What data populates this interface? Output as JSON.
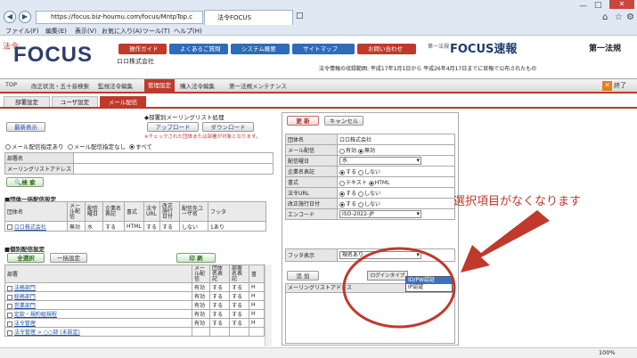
{
  "browser": {
    "url": "https://focus.biz-houmu.com/focus/MntpTop.c",
    "tab_title": "法令FOCUS",
    "menu": [
      "ファイル(F)",
      "編集(E)",
      "表示(V)",
      "お気に入り(A)",
      "ツール(T)",
      "ヘルプ(H)"
    ],
    "zoom": "100%"
  },
  "header": {
    "logo_small": "法令",
    "logo_main": "FOCUS",
    "links": [
      "操作ガイド",
      "よくあるご質問",
      "システム概要",
      "サイトマップ",
      "お問い合わせ"
    ],
    "link_colors": [
      "#c0392b",
      "#2e6bb8",
      "#2e6bb8",
      "#2e6bb8",
      "#c0392b"
    ],
    "company": "ロロ株式会社",
    "sokuhou_small": "第一法規",
    "sokuhou": "FOCUS速報",
    "daiichi": "第一法規",
    "info": "法令情報の収録範囲: 平成17年1月1日から 平成26年4月17日までに官報で公布されたもの"
  },
  "nav": {
    "items": [
      "TOP",
      "改正状況・五十音検索",
      "監視法令編集",
      "管理設定",
      "購入法令編集",
      "第一法規メンテナンス"
    ],
    "active": "管理設定",
    "exit": "終了"
  },
  "subtabs": [
    "部署設定",
    "ユーザ設定",
    "メール配信"
  ],
  "left": {
    "show_btn": "最新表示",
    "mailing_label": "◆部署別メーリングリスト処理",
    "upload_btn": "アップロード",
    "download_btn": "ダウンロード",
    "note": "※チェックされた団体または部署が対象となります。",
    "radio_options": [
      "メール配信指定あり",
      "メール配信指定なし",
      "すべて"
    ],
    "dept_name_label": "部署名",
    "ml_address_label": "メーリングリストアドレス",
    "search_btn": "検 索",
    "group_heading": "■団体一括配信設定",
    "group_headers": [
      "団体名",
      "メール配信",
      "配信曜日",
      "企業名表記",
      "書式",
      "法令URL",
      "改正施行日付",
      "配信先ユーザ名",
      "フッタ"
    ],
    "group_row": [
      "ロロ株式会社",
      "無効",
      "水",
      "する",
      "HTML",
      "する",
      "する",
      "しない",
      "1あり"
    ],
    "dept_heading": "■個別配信設定",
    "select_all_btn": "全選択",
    "bulk_btn": "一括設定",
    "print_btn": "印 刷",
    "dept_headers": [
      "部署",
      "メール配信",
      "団体名表記",
      "部署名表記",
      "書"
    ],
    "dept_rows": [
      {
        "name": "法務部門",
        "vals": [
          "有効",
          "する",
          "する",
          "H"
        ]
      },
      {
        "name": "総務部門",
        "vals": [
          "有効",
          "する",
          "する",
          "H"
        ]
      },
      {
        "name": "営業部門",
        "vals": [
          "有効",
          "する",
          "する",
          "H"
        ]
      },
      {
        "name": "定款・規約組規程",
        "vals": [
          "有効",
          "する",
          "する",
          "H"
        ]
      },
      {
        "name": "法令管理",
        "vals": [
          "有効",
          "する",
          "する",
          "H"
        ]
      },
      {
        "name": "法令管理 > ○○部 (未設定)",
        "vals": [
          "",
          "",
          "",
          ""
        ]
      }
    ]
  },
  "right": {
    "update_btn": "更 新",
    "cancel_btn": "キャンセル",
    "rows": {
      "group_name_label": "団体名",
      "group_name_value": "ロロ株式会社",
      "mail_label": "メール配信",
      "mail_opts": [
        "有効",
        "無効"
      ],
      "day_label": "配信曜日",
      "day_value": "水",
      "company_label": "企業名表記",
      "company_opts": [
        "する",
        "しない"
      ],
      "format_label": "書式",
      "format_opts": [
        "テキスト",
        "HTML"
      ],
      "url_label": "法令URL",
      "url_opts": [
        "する",
        "しない"
      ],
      "date_label": "改正施行日付",
      "date_opts": [
        "する",
        "しない"
      ],
      "encode_label": "エンコード",
      "encode_value": "ISO-2022-JP",
      "footer_label": "フッタ表示",
      "footer_value": "現名あり"
    },
    "add_btn": "追 加",
    "login_type_label": "ログインタイプ",
    "ml_header": "メーリングリストアドレス",
    "dropdown_options": [
      "ID/PW認証",
      "IP認証"
    ]
  },
  "annotation": "選択項目がなくなります",
  "annotation_color": "#c0392b"
}
